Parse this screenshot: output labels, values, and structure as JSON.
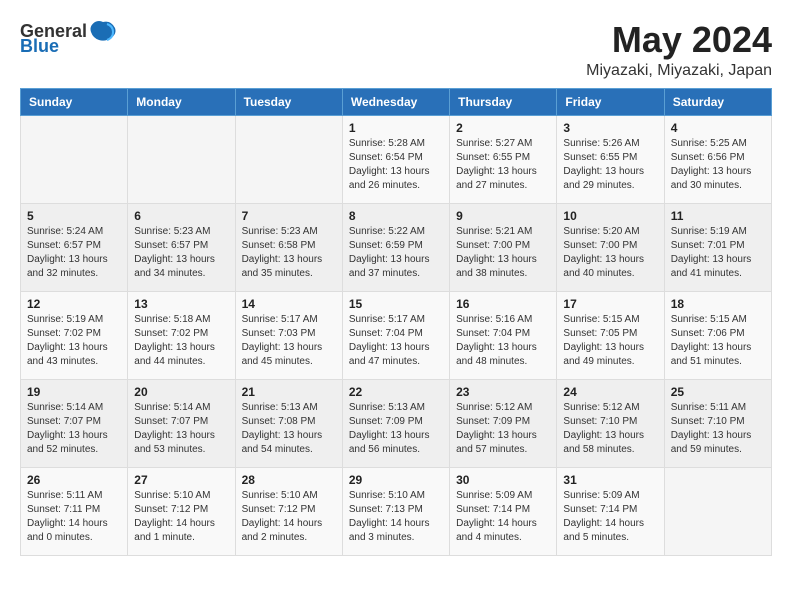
{
  "logo": {
    "general": "General",
    "blue": "Blue"
  },
  "header": {
    "month_year": "May 2024",
    "location": "Miyazaki, Miyazaki, Japan"
  },
  "weekdays": [
    "Sunday",
    "Monday",
    "Tuesday",
    "Wednesday",
    "Thursday",
    "Friday",
    "Saturday"
  ],
  "weeks": [
    [
      {
        "day": null
      },
      {
        "day": null
      },
      {
        "day": null
      },
      {
        "day": "1",
        "sunrise": "Sunrise: 5:28 AM",
        "sunset": "Sunset: 6:54 PM",
        "daylight": "Daylight: 13 hours and 26 minutes."
      },
      {
        "day": "2",
        "sunrise": "Sunrise: 5:27 AM",
        "sunset": "Sunset: 6:55 PM",
        "daylight": "Daylight: 13 hours and 27 minutes."
      },
      {
        "day": "3",
        "sunrise": "Sunrise: 5:26 AM",
        "sunset": "Sunset: 6:55 PM",
        "daylight": "Daylight: 13 hours and 29 minutes."
      },
      {
        "day": "4",
        "sunrise": "Sunrise: 5:25 AM",
        "sunset": "Sunset: 6:56 PM",
        "daylight": "Daylight: 13 hours and 30 minutes."
      }
    ],
    [
      {
        "day": "5",
        "sunrise": "Sunrise: 5:24 AM",
        "sunset": "Sunset: 6:57 PM",
        "daylight": "Daylight: 13 hours and 32 minutes."
      },
      {
        "day": "6",
        "sunrise": "Sunrise: 5:23 AM",
        "sunset": "Sunset: 6:57 PM",
        "daylight": "Daylight: 13 hours and 34 minutes."
      },
      {
        "day": "7",
        "sunrise": "Sunrise: 5:23 AM",
        "sunset": "Sunset: 6:58 PM",
        "daylight": "Daylight: 13 hours and 35 minutes."
      },
      {
        "day": "8",
        "sunrise": "Sunrise: 5:22 AM",
        "sunset": "Sunset: 6:59 PM",
        "daylight": "Daylight: 13 hours and 37 minutes."
      },
      {
        "day": "9",
        "sunrise": "Sunrise: 5:21 AM",
        "sunset": "Sunset: 7:00 PM",
        "daylight": "Daylight: 13 hours and 38 minutes."
      },
      {
        "day": "10",
        "sunrise": "Sunrise: 5:20 AM",
        "sunset": "Sunset: 7:00 PM",
        "daylight": "Daylight: 13 hours and 40 minutes."
      },
      {
        "day": "11",
        "sunrise": "Sunrise: 5:19 AM",
        "sunset": "Sunset: 7:01 PM",
        "daylight": "Daylight: 13 hours and 41 minutes."
      }
    ],
    [
      {
        "day": "12",
        "sunrise": "Sunrise: 5:19 AM",
        "sunset": "Sunset: 7:02 PM",
        "daylight": "Daylight: 13 hours and 43 minutes."
      },
      {
        "day": "13",
        "sunrise": "Sunrise: 5:18 AM",
        "sunset": "Sunset: 7:02 PM",
        "daylight": "Daylight: 13 hours and 44 minutes."
      },
      {
        "day": "14",
        "sunrise": "Sunrise: 5:17 AM",
        "sunset": "Sunset: 7:03 PM",
        "daylight": "Daylight: 13 hours and 45 minutes."
      },
      {
        "day": "15",
        "sunrise": "Sunrise: 5:17 AM",
        "sunset": "Sunset: 7:04 PM",
        "daylight": "Daylight: 13 hours and 47 minutes."
      },
      {
        "day": "16",
        "sunrise": "Sunrise: 5:16 AM",
        "sunset": "Sunset: 7:04 PM",
        "daylight": "Daylight: 13 hours and 48 minutes."
      },
      {
        "day": "17",
        "sunrise": "Sunrise: 5:15 AM",
        "sunset": "Sunset: 7:05 PM",
        "daylight": "Daylight: 13 hours and 49 minutes."
      },
      {
        "day": "18",
        "sunrise": "Sunrise: 5:15 AM",
        "sunset": "Sunset: 7:06 PM",
        "daylight": "Daylight: 13 hours and 51 minutes."
      }
    ],
    [
      {
        "day": "19",
        "sunrise": "Sunrise: 5:14 AM",
        "sunset": "Sunset: 7:07 PM",
        "daylight": "Daylight: 13 hours and 52 minutes."
      },
      {
        "day": "20",
        "sunrise": "Sunrise: 5:14 AM",
        "sunset": "Sunset: 7:07 PM",
        "daylight": "Daylight: 13 hours and 53 minutes."
      },
      {
        "day": "21",
        "sunrise": "Sunrise: 5:13 AM",
        "sunset": "Sunset: 7:08 PM",
        "daylight": "Daylight: 13 hours and 54 minutes."
      },
      {
        "day": "22",
        "sunrise": "Sunrise: 5:13 AM",
        "sunset": "Sunset: 7:09 PM",
        "daylight": "Daylight: 13 hours and 56 minutes."
      },
      {
        "day": "23",
        "sunrise": "Sunrise: 5:12 AM",
        "sunset": "Sunset: 7:09 PM",
        "daylight": "Daylight: 13 hours and 57 minutes."
      },
      {
        "day": "24",
        "sunrise": "Sunrise: 5:12 AM",
        "sunset": "Sunset: 7:10 PM",
        "daylight": "Daylight: 13 hours and 58 minutes."
      },
      {
        "day": "25",
        "sunrise": "Sunrise: 5:11 AM",
        "sunset": "Sunset: 7:10 PM",
        "daylight": "Daylight: 13 hours and 59 minutes."
      }
    ],
    [
      {
        "day": "26",
        "sunrise": "Sunrise: 5:11 AM",
        "sunset": "Sunset: 7:11 PM",
        "daylight": "Daylight: 14 hours and 0 minutes."
      },
      {
        "day": "27",
        "sunrise": "Sunrise: 5:10 AM",
        "sunset": "Sunset: 7:12 PM",
        "daylight": "Daylight: 14 hours and 1 minute."
      },
      {
        "day": "28",
        "sunrise": "Sunrise: 5:10 AM",
        "sunset": "Sunset: 7:12 PM",
        "daylight": "Daylight: 14 hours and 2 minutes."
      },
      {
        "day": "29",
        "sunrise": "Sunrise: 5:10 AM",
        "sunset": "Sunset: 7:13 PM",
        "daylight": "Daylight: 14 hours and 3 minutes."
      },
      {
        "day": "30",
        "sunrise": "Sunrise: 5:09 AM",
        "sunset": "Sunset: 7:14 PM",
        "daylight": "Daylight: 14 hours and 4 minutes."
      },
      {
        "day": "31",
        "sunrise": "Sunrise: 5:09 AM",
        "sunset": "Sunset: 7:14 PM",
        "daylight": "Daylight: 14 hours and 5 minutes."
      },
      {
        "day": null
      }
    ]
  ]
}
